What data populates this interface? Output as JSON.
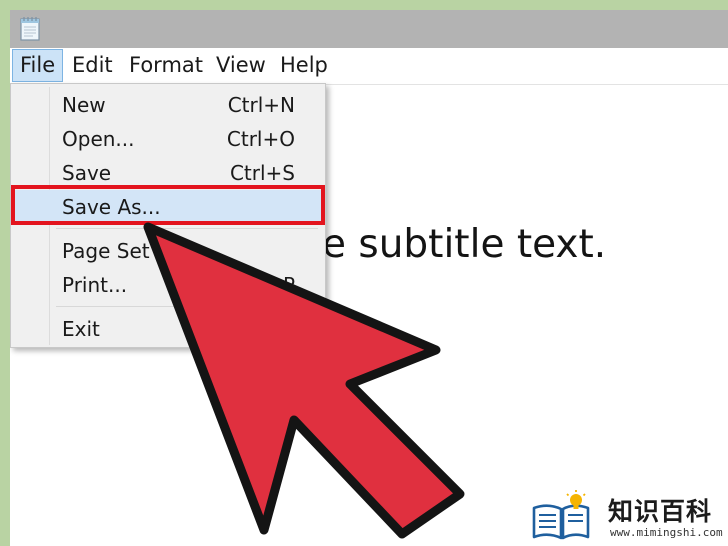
{
  "menubar": {
    "items": [
      {
        "label": "File",
        "active": true
      },
      {
        "label": "Edit",
        "active": false
      },
      {
        "label": "Format",
        "active": false
      },
      {
        "label": "View",
        "active": false
      },
      {
        "label": "Help",
        "active": false
      }
    ]
  },
  "file_menu": {
    "items": [
      {
        "label": "New",
        "shortcut": "Ctrl+N"
      },
      {
        "label": "Open...",
        "shortcut": "Ctrl+O"
      },
      {
        "label": "Save",
        "shortcut": "Ctrl+S"
      },
      {
        "label": "Save As...",
        "shortcut": "",
        "highlighted": true
      },
      {
        "label": "Page Set",
        "shortcut": ""
      },
      {
        "label": "Print...",
        "shortcut": "P"
      },
      {
        "label": "Exit",
        "shortcut": ""
      }
    ]
  },
  "document": {
    "visible_text": "e subtitle text."
  },
  "annotation": {
    "highlight_color": "#e3141e",
    "arrow_color": "#e0303f"
  },
  "watermark": {
    "title": "知识百科",
    "url": "www.mimingshi.com"
  }
}
